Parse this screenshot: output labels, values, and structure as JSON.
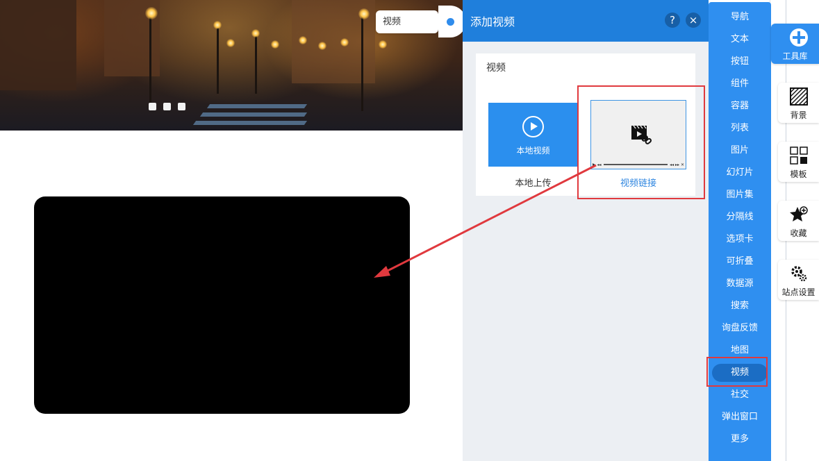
{
  "tooltip": {
    "label": "视频"
  },
  "panel": {
    "title": "添加视频",
    "help_label": "?",
    "close_label": "×",
    "section_title": "视频",
    "local_tile_label": "本地视频",
    "local_caption": "本地上传",
    "link_caption": "视频链接"
  },
  "menu": {
    "items": [
      {
        "label": "导航"
      },
      {
        "label": "文本"
      },
      {
        "label": "按钮"
      },
      {
        "label": "组件"
      },
      {
        "label": "容器"
      },
      {
        "label": "列表"
      },
      {
        "label": "图片"
      },
      {
        "label": "幻灯片"
      },
      {
        "label": "图片集"
      },
      {
        "label": "分隔线"
      },
      {
        "label": "选项卡"
      },
      {
        "label": "可折叠"
      },
      {
        "label": "数据源"
      },
      {
        "label": "搜索"
      },
      {
        "label": "询盘反馈"
      },
      {
        "label": "地图"
      },
      {
        "label": "视频"
      },
      {
        "label": "社交"
      },
      {
        "label": "弹出窗口"
      },
      {
        "label": "更多"
      }
    ],
    "active": "视频"
  },
  "toolbar": {
    "items": [
      {
        "label": "工具库",
        "icon": "plus-icon"
      },
      {
        "label": "背景",
        "icon": "background-icon"
      },
      {
        "label": "模板",
        "icon": "template-icon"
      },
      {
        "label": "收藏",
        "icon": "star-icon"
      },
      {
        "label": "站点设置",
        "icon": "gear-icon"
      }
    ]
  },
  "colors": {
    "accent": "#2f8ff0",
    "header": "#1f7fdc",
    "highlight": "#e0393e"
  }
}
